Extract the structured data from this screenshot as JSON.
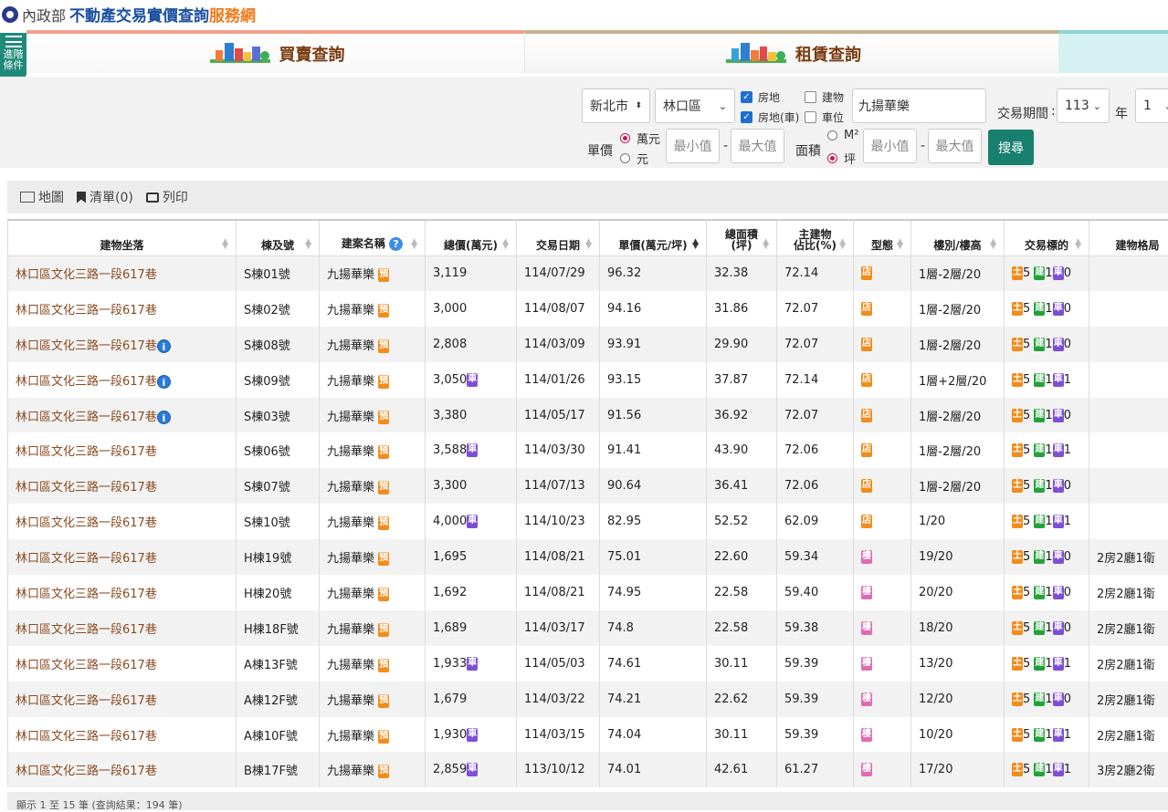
{
  "header": {
    "ministry": "內政部",
    "title_blue": "不動產交易實價查詢",
    "title_orange": "服務網"
  },
  "tabs": {
    "advanced_line1": "進階",
    "advanced_line2": "條件",
    "buy": "買賣查詢",
    "rent": "租賃查詢"
  },
  "search": {
    "city": "新北市",
    "district": "林口區",
    "opt_house_land": "房地",
    "opt_house_land_car": "房地(車)",
    "opt_building": "建物",
    "opt_parking": "車位",
    "keyword": "九揚華樂",
    "period_label": "交易期間",
    "year": "113",
    "year_unit": "年",
    "month": "1",
    "unit_price_label": "單價",
    "unit_wan": "萬元",
    "unit_yuan": "元",
    "min": "最小值",
    "max": "最大值",
    "area_label": "面積",
    "area_m2": "M²",
    "area_ping": "坪",
    "dash": "-",
    "search_button": "搜尋"
  },
  "toolbar": {
    "map": "地圖",
    "list": "清單(0)",
    "print": "列印"
  },
  "table": {
    "headers": [
      "建物坐落",
      "棟及號",
      "建案名稱",
      "總價(萬元)",
      "交易日期",
      "單價(萬元/坪)",
      "總面積(坪)",
      "主建物佔比(%)",
      "型態",
      "樓別/樓高",
      "交易標的",
      "建物格局"
    ],
    "header_area_l1": "總面積",
    "header_area_l2": "(坪)",
    "header_main_l1": "主建物",
    "header_main_l2": "佔比(%)",
    "rows": [
      {
        "addr": "林口區文化三路一段617巷",
        "info": false,
        "unit": "S棟01號",
        "project": "九揚華樂",
        "price": "3,119",
        "car": false,
        "date": "114/07/29",
        "unit_price": "96.32",
        "area": "32.38",
        "main": "72.14",
        "type": "店",
        "floor": "1層-2層/20",
        "land": "5",
        "bldg": "1",
        "park": "0",
        "layout": ""
      },
      {
        "addr": "林口區文化三路一段617巷",
        "info": false,
        "unit": "S棟02號",
        "project": "九揚華樂",
        "price": "3,000",
        "car": false,
        "date": "114/08/07",
        "unit_price": "94.16",
        "area": "31.86",
        "main": "72.07",
        "type": "店",
        "floor": "1層-2層/20",
        "land": "5",
        "bldg": "1",
        "park": "0",
        "layout": ""
      },
      {
        "addr": "林口區文化三路一段617巷",
        "info": true,
        "unit": "S棟08號",
        "project": "九揚華樂",
        "price": "2,808",
        "car": false,
        "date": "114/03/09",
        "unit_price": "93.91",
        "area": "29.90",
        "main": "72.07",
        "type": "店",
        "floor": "1層-2層/20",
        "land": "5",
        "bldg": "1",
        "park": "0",
        "layout": ""
      },
      {
        "addr": "林口區文化三路一段617巷",
        "info": true,
        "unit": "S棟09號",
        "project": "九揚華樂",
        "price": "3,050",
        "car": true,
        "date": "114/01/26",
        "unit_price": "93.15",
        "area": "37.87",
        "main": "72.14",
        "type": "店",
        "floor": "1層+2層/20",
        "land": "5",
        "bldg": "1",
        "park": "1",
        "layout": ""
      },
      {
        "addr": "林口區文化三路一段617巷",
        "info": true,
        "unit": "S棟03號",
        "project": "九揚華樂",
        "price": "3,380",
        "car": false,
        "date": "114/05/17",
        "unit_price": "91.56",
        "area": "36.92",
        "main": "72.07",
        "type": "店",
        "floor": "1層-2層/20",
        "land": "5",
        "bldg": "1",
        "park": "0",
        "layout": ""
      },
      {
        "addr": "林口區文化三路一段617巷",
        "info": false,
        "unit": "S棟06號",
        "project": "九揚華樂",
        "price": "3,588",
        "car": true,
        "date": "114/03/30",
        "unit_price": "91.41",
        "area": "43.90",
        "main": "72.06",
        "type": "店",
        "floor": "1層-2層/20",
        "land": "5",
        "bldg": "1",
        "park": "1",
        "layout": ""
      },
      {
        "addr": "林口區文化三路一段617巷",
        "info": false,
        "unit": "S棟07號",
        "project": "九揚華樂",
        "price": "3,300",
        "car": false,
        "date": "114/07/13",
        "unit_price": "90.64",
        "area": "36.41",
        "main": "72.06",
        "type": "店",
        "floor": "1層-2層/20",
        "land": "5",
        "bldg": "1",
        "park": "0",
        "layout": ""
      },
      {
        "addr": "林口區文化三路一段617巷",
        "info": false,
        "unit": "S棟10號",
        "project": "九揚華樂",
        "price": "4,000",
        "car": true,
        "date": "114/10/23",
        "unit_price": "82.95",
        "area": "52.52",
        "main": "62.09",
        "type": "店",
        "floor": "1/20",
        "land": "5",
        "bldg": "1",
        "park": "1",
        "layout": ""
      },
      {
        "addr": "林口區文化三路一段617巷",
        "info": false,
        "unit": "H棟19號",
        "project": "九揚華樂",
        "price": "1,695",
        "car": false,
        "date": "114/08/21",
        "unit_price": "75.01",
        "area": "22.60",
        "main": "59.34",
        "type": "樓",
        "floor": "19/20",
        "land": "5",
        "bldg": "1",
        "park": "0",
        "layout": "2房2廳1衛"
      },
      {
        "addr": "林口區文化三路一段617巷",
        "info": false,
        "unit": "H棟20號",
        "project": "九揚華樂",
        "price": "1,692",
        "car": false,
        "date": "114/08/21",
        "unit_price": "74.95",
        "area": "22.58",
        "main": "59.40",
        "type": "樓",
        "floor": "20/20",
        "land": "5",
        "bldg": "1",
        "park": "0",
        "layout": "2房2廳1衛"
      },
      {
        "addr": "林口區文化三路一段617巷",
        "info": false,
        "unit": "H棟18F號",
        "project": "九揚華樂",
        "price": "1,689",
        "car": false,
        "date": "114/03/17",
        "unit_price": "74.8",
        "area": "22.58",
        "main": "59.38",
        "type": "樓",
        "floor": "18/20",
        "land": "5",
        "bldg": "1",
        "park": "0",
        "layout": "2房2廳1衛"
      },
      {
        "addr": "林口區文化三路一段617巷",
        "info": false,
        "unit": "A棟13F號",
        "project": "九揚華樂",
        "price": "1,933",
        "car": true,
        "date": "114/05/03",
        "unit_price": "74.61",
        "area": "30.11",
        "main": "59.39",
        "type": "樓",
        "floor": "13/20",
        "land": "5",
        "bldg": "1",
        "park": "1",
        "layout": "2房2廳1衛"
      },
      {
        "addr": "林口區文化三路一段617巷",
        "info": false,
        "unit": "A棟12F號",
        "project": "九揚華樂",
        "price": "1,679",
        "car": false,
        "date": "114/03/22",
        "unit_price": "74.21",
        "area": "22.62",
        "main": "59.39",
        "type": "樓",
        "floor": "12/20",
        "land": "5",
        "bldg": "1",
        "park": "0",
        "layout": "2房2廳1衛"
      },
      {
        "addr": "林口區文化三路一段617巷",
        "info": false,
        "unit": "A棟10F號",
        "project": "九揚華樂",
        "price": "1,930",
        "car": true,
        "date": "114/03/15",
        "unit_price": "74.04",
        "area": "30.11",
        "main": "59.39",
        "type": "樓",
        "floor": "10/20",
        "land": "5",
        "bldg": "1",
        "park": "1",
        "layout": "2房2廳1衛"
      },
      {
        "addr": "林口區文化三路一段617巷",
        "info": false,
        "unit": "B棟17F號",
        "project": "九揚華樂",
        "price": "2,859",
        "car": true,
        "date": "113/10/12",
        "unit_price": "74.01",
        "area": "42.61",
        "main": "61.27",
        "type": "樓",
        "floor": "17/20",
        "land": "5",
        "bldg": "1",
        "park": "1",
        "layout": "3房2廳2衛"
      }
    ]
  },
  "tags": {
    "presale": "預",
    "car": "車",
    "land": "土",
    "bldg": "建",
    "park": "車"
  },
  "footer": "顯示 1 至 15 筆 (查詢結果：194 筆)",
  "colors": {
    "brand_blue": "#1a4fa0",
    "brand_orange": "#f07b1e",
    "search_green": "#17806e",
    "address_brown": "#8a4a20"
  }
}
